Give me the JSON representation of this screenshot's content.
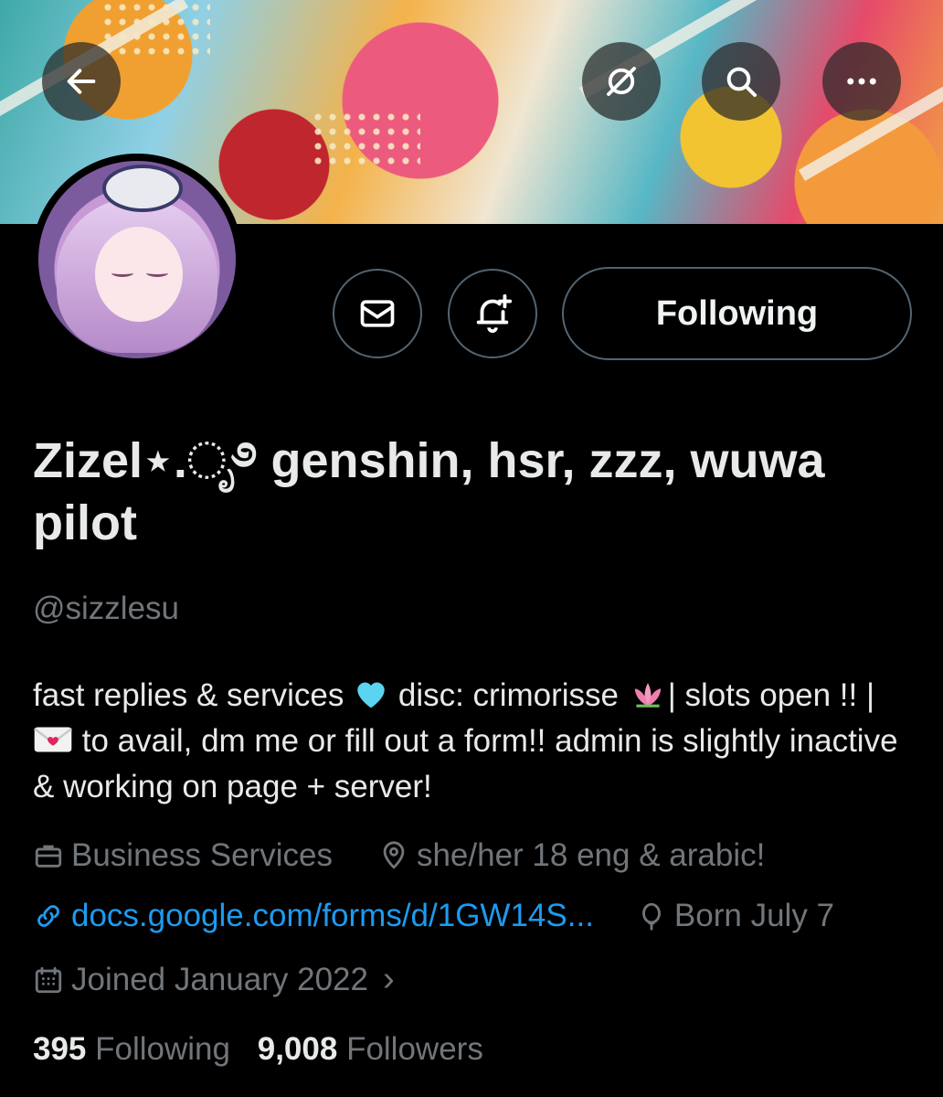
{
  "header": {
    "back_icon": "arrow-left-icon",
    "grok_icon": "grok-slash-icon",
    "search_icon": "search-icon",
    "more_icon": "more-horizontal-icon"
  },
  "actions": {
    "message_icon": "mail-icon",
    "notify_icon": "bell-plus-icon",
    "follow_label": "Following"
  },
  "profile": {
    "name": "Zizel⋆.ೃ࿔ genshin, hsr, zzz, wuwa pilot",
    "handle": "@sizzlesu",
    "bio": {
      "part1": "fast replies & services ",
      "part2": " disc: crimorisse ",
      "part3": "| slots open !! | ",
      "part4": " to avail, dm me or fill out a form!! admin is slightly inactive & working on page + server!"
    },
    "category": "Business Services",
    "location": "she/her 18 eng & arabic!",
    "website": "docs.google.com/forms/d/1GW14S...",
    "birthday": "Born July 7",
    "joined": "Joined January 2022",
    "joined_chevron": "›"
  },
  "stats": {
    "following_count": "395",
    "following_label": "Following",
    "followers_count": "9,008",
    "followers_label": "Followers"
  },
  "colors": {
    "background": "#000000",
    "text": "#e7e9ea",
    "muted": "#71767b",
    "link": "#1d9bf0",
    "border": "#536471"
  }
}
